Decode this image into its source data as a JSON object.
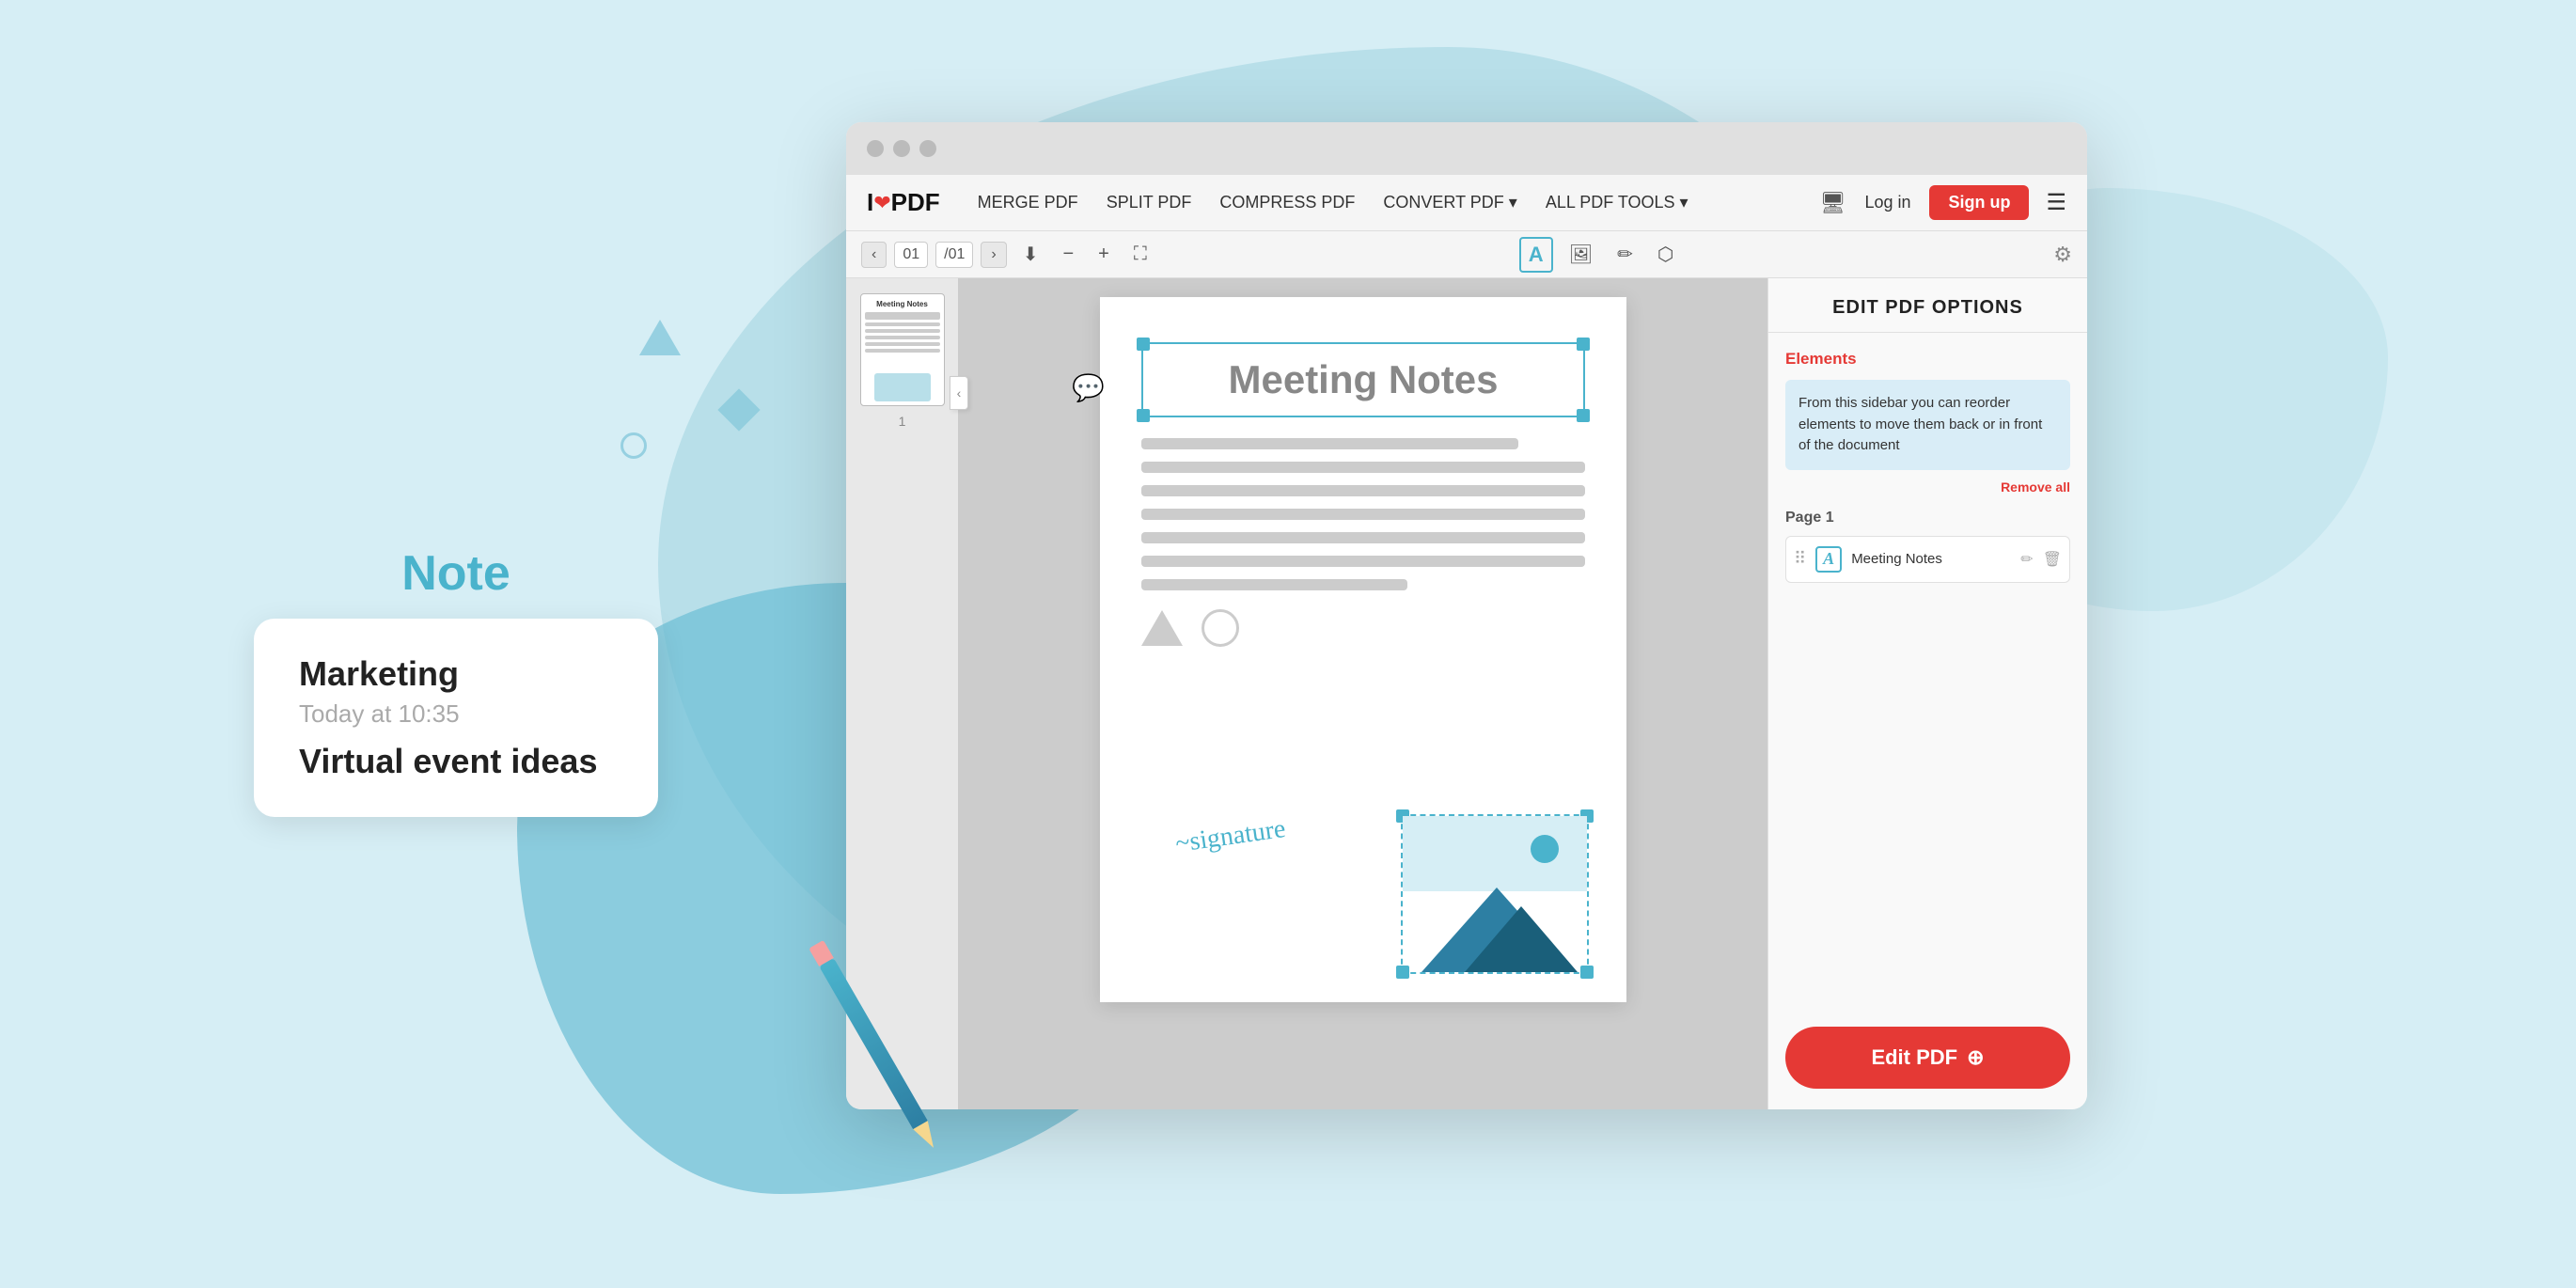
{
  "page": {
    "background_color": "#d6eef5"
  },
  "note_card": {
    "label": "Note",
    "title": "Marketing",
    "time": "Today at 10:35",
    "content": "Virtual event ideas"
  },
  "browser": {
    "titlebar": {
      "dots": [
        "gray",
        "gray",
        "gray"
      ]
    },
    "navbar": {
      "logo": "I❤PDF",
      "logo_i": "I",
      "logo_heart": "❤",
      "logo_pdf": "PDF",
      "nav_items": [
        "MERGE PDF",
        "SPLIT PDF",
        "COMPRESS PDF",
        "CONVERT PDF ▾",
        "ALL PDF TOOLS ▾"
      ],
      "login_label": "Log in",
      "signup_label": "Sign up",
      "hamburger": "☰"
    },
    "toolbar": {
      "prev_btn": "‹",
      "next_btn": "›",
      "page_current": "01",
      "page_total": "/01",
      "download_icon": "⬇",
      "zoom_out_icon": "−",
      "zoom_in_icon": "+",
      "fit_icon": "⛶",
      "text_icon": "T",
      "image_icon": "🖼",
      "pencil_icon": "✏",
      "shape_icon": "⬡",
      "gear_icon": "⚙"
    },
    "pdf_sidebar": {
      "page_number": "1"
    },
    "pdf_heading": "Meeting Notes",
    "pdf_elements_placeholder": "element lines",
    "edit_sidebar": {
      "title": "EDIT PDF OPTIONS",
      "elements_label": "Elements",
      "info_text": "From this sidebar you can reorder elements to move them back or in front of the document",
      "remove_all": "Remove all",
      "page_label": "Page 1",
      "element_name": "Meeting Notes",
      "edit_pdf_btn": "Edit PDF"
    }
  }
}
